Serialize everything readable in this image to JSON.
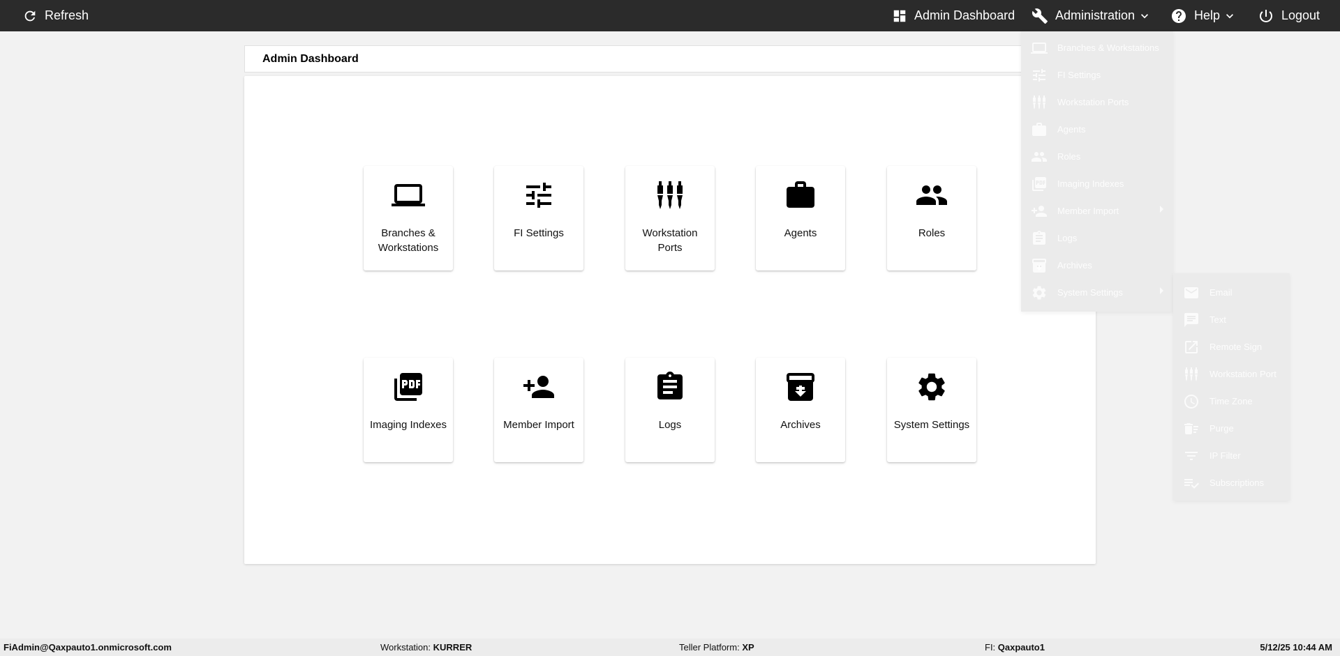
{
  "topbar": {
    "refresh_label": "Refresh",
    "admin_dashboard_label": "Admin Dashboard",
    "administration_label": "Administration",
    "help_label": "Help",
    "logout_label": "Logout"
  },
  "page": {
    "title": "Admin Dashboard"
  },
  "tiles": [
    {
      "label": "Branches & Workstations",
      "icon": "laptop-icon"
    },
    {
      "label": "FI Settings",
      "icon": "tune-icon"
    },
    {
      "label": "Workstation Ports",
      "icon": "ports-icon"
    },
    {
      "label": "Agents",
      "icon": "briefcase-icon"
    },
    {
      "label": "Roles",
      "icon": "people-icon"
    },
    {
      "label": "Imaging Indexes",
      "icon": "pdf-icon"
    },
    {
      "label": "Member Import",
      "icon": "person-add-icon"
    },
    {
      "label": "Logs",
      "icon": "clipboard-icon"
    },
    {
      "label": "Archives",
      "icon": "archive-icon"
    },
    {
      "label": "System Settings",
      "icon": "gear-icon"
    }
  ],
  "admin_menu": [
    {
      "label": "Branches & Workstations",
      "icon": "laptop-icon"
    },
    {
      "label": "FI Settings",
      "icon": "tune-icon"
    },
    {
      "label": "Workstation Ports",
      "icon": "ports-icon"
    },
    {
      "label": "Agents",
      "icon": "briefcase-icon"
    },
    {
      "label": "Roles",
      "icon": "people-icon"
    },
    {
      "label": "Imaging Indexes",
      "icon": "pdf-icon"
    },
    {
      "label": "Member Import",
      "icon": "person-add-icon"
    },
    {
      "label": "Logs",
      "icon": "clipboard-icon"
    },
    {
      "label": "Archives",
      "icon": "archive-icon"
    },
    {
      "label": "System Settings",
      "icon": "gear-icon"
    }
  ],
  "system_settings_menu": [
    {
      "label": "Email",
      "icon": "mail-icon"
    },
    {
      "label": "Text",
      "icon": "chat-icon"
    },
    {
      "label": "Remote Sign",
      "icon": "open-in-new-icon"
    },
    {
      "label": "Workstation Port",
      "icon": "ports-icon"
    },
    {
      "label": "Time Zone",
      "icon": "clock-icon"
    },
    {
      "label": "Purge",
      "icon": "delete-sweep-icon"
    },
    {
      "label": "IP Filter",
      "icon": "filter-icon"
    },
    {
      "label": "Subscriptions",
      "icon": "playlist-check-icon"
    }
  ],
  "status": {
    "user": "FiAdmin@Qaxpauto1.onmicrosoft.com",
    "workstation_label": "Workstation:",
    "workstation_value": "KURRER",
    "platform_label": "Teller Platform:",
    "platform_value": "XP",
    "fi_label": "FI:",
    "fi_value": "Qaxpauto1",
    "datetime": "5/12/25 10:44 AM"
  }
}
